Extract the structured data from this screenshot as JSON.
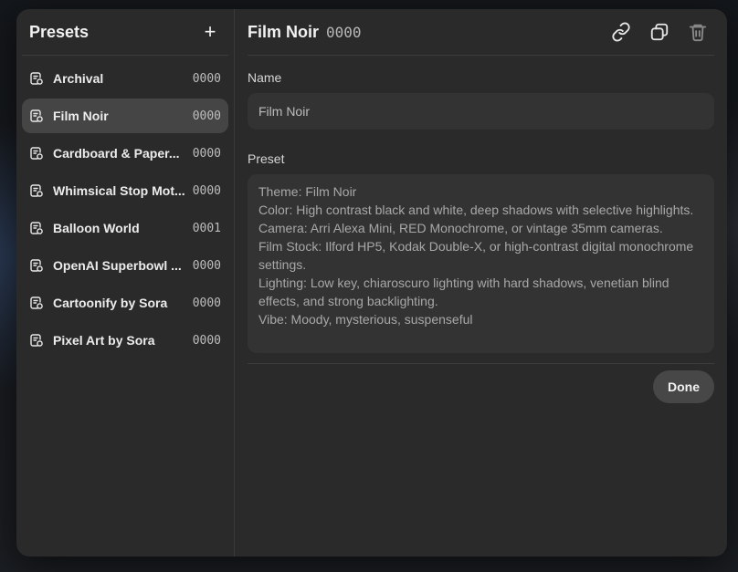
{
  "sidebar": {
    "title": "Presets",
    "add_label": "+",
    "items": [
      {
        "label": "Archival",
        "count": "0000"
      },
      {
        "label": "Film Noir",
        "count": "0000"
      },
      {
        "label": "Cardboard & Paper...",
        "count": "0000"
      },
      {
        "label": "Whimsical Stop Mot...",
        "count": "0000"
      },
      {
        "label": "Balloon World",
        "count": "0001"
      },
      {
        "label": "OpenAI Superbowl ...",
        "count": "0000"
      },
      {
        "label": "Cartoonify by Sora",
        "count": "0000"
      },
      {
        "label": "Pixel Art by Sora",
        "count": "0000"
      }
    ]
  },
  "main": {
    "title": "Film Noir",
    "count": "0000",
    "actions": [
      "link-icon",
      "duplicate-icon",
      "trash-icon"
    ],
    "name_label": "Name",
    "name_value": "Film Noir",
    "preset_label": "Preset",
    "preset_value": "Theme: Film Noir\nColor: High contrast black and white, deep shadows with selective highlights.\nCamera: Arri Alexa Mini, RED Monochrome, or vintage 35mm cameras.\nFilm Stock: Ilford HP5, Kodak Double-X, or high-contrast digital monochrome settings.\nLighting: Low key, chiaroscuro lighting with hard shadows, venetian blind effects, and strong backlighting.\nVibe: Moody, mysterious, suspenseful",
    "done_label": "Done"
  },
  "colors": {
    "modal_bg": "#2a2a2a",
    "active_item": "#454545",
    "input_bg": "#333333"
  }
}
